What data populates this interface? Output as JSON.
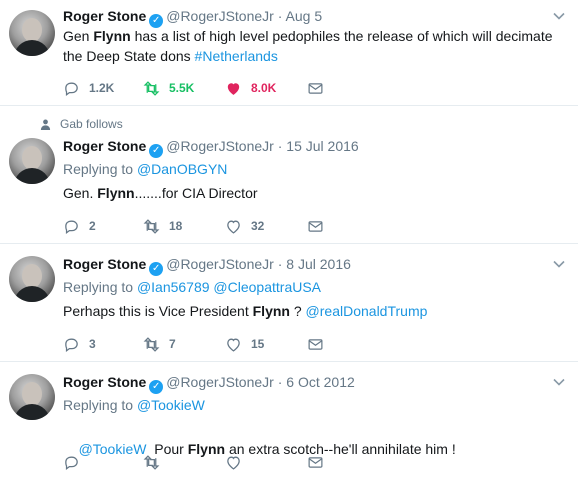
{
  "tweets": [
    {
      "name": "Roger Stone",
      "handle": "@RogerJStoneJr",
      "separator": "·",
      "time": "Aug 5",
      "replying_label": "",
      "replying_to": "",
      "text_parts": [
        "Gen ",
        "Flynn",
        " has a list of high level pedophiles the release of which will decimate the Deep State dons ",
        "#Netherlands"
      ],
      "reply_count": "1.2K",
      "retweet_count": "5.5K",
      "like_count": "8.0K"
    },
    {
      "name": "Roger Stone",
      "handle": "@RogerJStoneJr",
      "separator": "·",
      "time": "15 Jul 2016",
      "replying_label": "Replying to",
      "replying_to": "@DanOBGYN",
      "text_parts": [
        "Gen. ",
        "Flynn",
        ".......for CIA Director"
      ],
      "reply_count": "2",
      "retweet_count": "18",
      "like_count": "32"
    },
    {
      "name": "Roger Stone",
      "handle": "@RogerJStoneJr",
      "separator": "·",
      "time": "8 Jul 2016",
      "replying_label": "Replying to",
      "replying_to": "@Ian56789 @CleopattraUSA",
      "text_parts": [
        "Perhaps this is Vice President ",
        "Flynn",
        " ? ",
        "@realDonaldTrump"
      ],
      "reply_count": "3",
      "retweet_count": "7",
      "like_count": "15"
    },
    {
      "name": "Roger Stone",
      "handle": "@RogerJStoneJr",
      "separator": "·",
      "time": "6 Oct 2012",
      "replying_label": "Replying to",
      "replying_to": "@TookieW",
      "text_parts": [
        "@TookieW",
        "  Pour ",
        "Flynn",
        " an extra scotch--he'll annihilate him !"
      ],
      "reply_count": "",
      "retweet_count": "",
      "like_count": ""
    }
  ],
  "social_context": "Gab follows",
  "colors": {
    "link": "#1b95e0",
    "retweet_active": "#17bf63",
    "like_active": "#e0245e",
    "muted": "#657786"
  }
}
